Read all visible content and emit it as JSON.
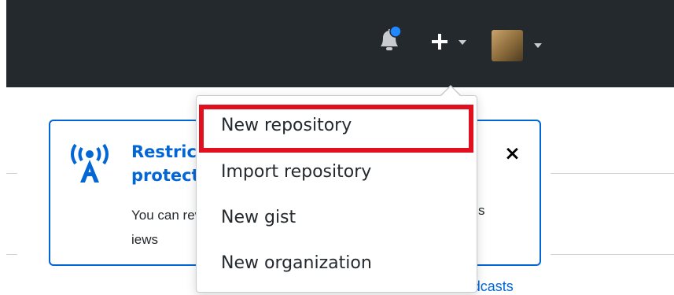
{
  "header": {
    "notifications_icon": "bell-icon",
    "notification_dot_color": "#2188ff",
    "create_icon": "plus-icon",
    "avatar_icon": "user-avatar"
  },
  "create_menu": {
    "items": [
      {
        "label": "New repository",
        "highlighted": true
      },
      {
        "label": "Import repository"
      },
      {
        "label": "New gist"
      },
      {
        "label": "New organization"
      }
    ],
    "highlight_color": "#e0101e"
  },
  "broadcast": {
    "icon": "broadcast-icon",
    "title_visible": "Restric protect",
    "body_visible_left": "You can reviews",
    "body_visible_right": "s",
    "close_label": "×"
  },
  "footer_link": "View all new broadcasts",
  "colors": {
    "header_bg": "#24292e",
    "link_blue": "#0366d6"
  }
}
